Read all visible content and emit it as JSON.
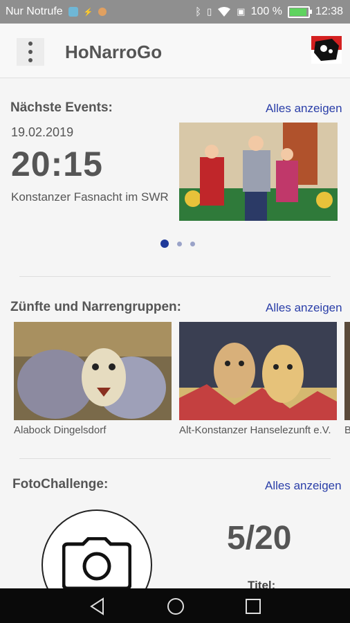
{
  "status_bar": {
    "carrier": "Nur Notrufe",
    "battery_percent": "100 %",
    "time": "12:38",
    "icons": [
      "android-icon",
      "usb-icon",
      "app-icon",
      "bluetooth-icon",
      "vibrate-icon",
      "wifi-icon",
      "sim-icon",
      "battery-charging-icon"
    ]
  },
  "app_bar": {
    "title": "HoNarroGo",
    "menu_icon": "overflow-menu-icon",
    "logo_icon": "honarro-logo-icon"
  },
  "events": {
    "title": "Nächste Events:",
    "show_all": "Alles anzeigen",
    "date": "19.02.2019",
    "time": "20:15",
    "name": "Konstanzer Fasnacht im SWR",
    "image": "stage-performance-photo",
    "pager": {
      "count": 3,
      "active": 0
    }
  },
  "guilds": {
    "title": "Zünfte und Narrengruppen:",
    "show_all": "Alles anzeigen",
    "items": [
      {
        "label": "Alabock Dingelsdorf",
        "image": "feathered-mask-photo"
      },
      {
        "label": "Alt-Konstanzer Hanselezunft e.V.",
        "image": "wooden-masks-photo"
      },
      {
        "label": "B",
        "image": "partial-mask-photo"
      }
    ]
  },
  "photo_challenge": {
    "title": "FotoChallenge:",
    "show_all": "Alles anzeigen",
    "camera_icon": "camera-icon",
    "progress": "5/20",
    "titel_label": "Titel:"
  },
  "nav_bar": {
    "icons": [
      "back-icon",
      "home-icon",
      "recents-icon"
    ]
  },
  "colors": {
    "accent": "#2a3ea8",
    "status_bar": "#8f8f8f",
    "nav_bar": "#0a0a0a"
  }
}
